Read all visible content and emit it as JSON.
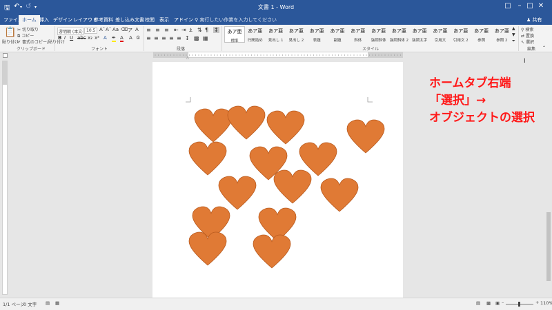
{
  "titlebar": {
    "title": "文書 1 - Word",
    "save_icon": "save-icon",
    "undo_icon": "undo-icon",
    "redo_icon": "redo-icon",
    "customize_icon": "customize-qa-icon"
  },
  "tabs": [
    "ファイル",
    "ホーム",
    "挿入",
    "デザイン",
    "レイアウト",
    "参考資料",
    "差し込み文書",
    "校閲",
    "表示",
    "アドイン"
  ],
  "active_tab": "ホーム",
  "tell_me": "実行したい作業を入力してください",
  "share": "共有",
  "clipboard": {
    "paste": "貼り付け",
    "cut": "切り取り",
    "copy": "コピー",
    "format_painter": "書式のコピー/貼り付け",
    "group_label": "クリップボード"
  },
  "font": {
    "name": "游明朝 (本文のフォント",
    "size": "10.5",
    "group_label": "フォント"
  },
  "paragraph": {
    "group_label": "段落"
  },
  "styles": {
    "group_label": "スタイル",
    "items": [
      {
        "preview": "あア亜",
        "name": "標準",
        "selected": true
      },
      {
        "preview": "あア亜",
        "name": "行間詰め",
        "selected": false
      },
      {
        "preview": "あア亜",
        "name": "見出し 1",
        "selected": false
      },
      {
        "preview": "あア亜",
        "name": "見出し 2",
        "selected": false
      },
      {
        "preview": "あア亜",
        "name": "表題",
        "selected": false
      },
      {
        "preview": "あア亜",
        "name": "副題",
        "selected": false
      },
      {
        "preview": "あア亜",
        "name": "斜体",
        "selected": false
      },
      {
        "preview": "あア亜",
        "name": "強調斜体",
        "selected": false
      },
      {
        "preview": "あア亜",
        "name": "強調斜体 2",
        "selected": false
      },
      {
        "preview": "あア亜",
        "name": "強調太字",
        "selected": false
      },
      {
        "preview": "あア亜",
        "name": "引用文",
        "selected": false
      },
      {
        "preview": "あア亜",
        "name": "引用文 2",
        "selected": false
      },
      {
        "preview": "あア亜",
        "name": "参照",
        "selected": false
      },
      {
        "preview": "あア亜",
        "name": "参照 2",
        "selected": false
      }
    ]
  },
  "editing": {
    "find": "検索",
    "replace": "置換",
    "select": "選択",
    "group_label": "編集"
  },
  "annotation": {
    "lines": [
      "ホームタブ右端",
      "「選択」→",
      "オブジェクトの選択"
    ],
    "color": "#ff1a1a"
  },
  "shape_fill": "#e07a35",
  "shape_stroke": "#b85a1e",
  "status": {
    "page": "1/1 ページ",
    "words": "0 文字",
    "zoom": "110%"
  }
}
